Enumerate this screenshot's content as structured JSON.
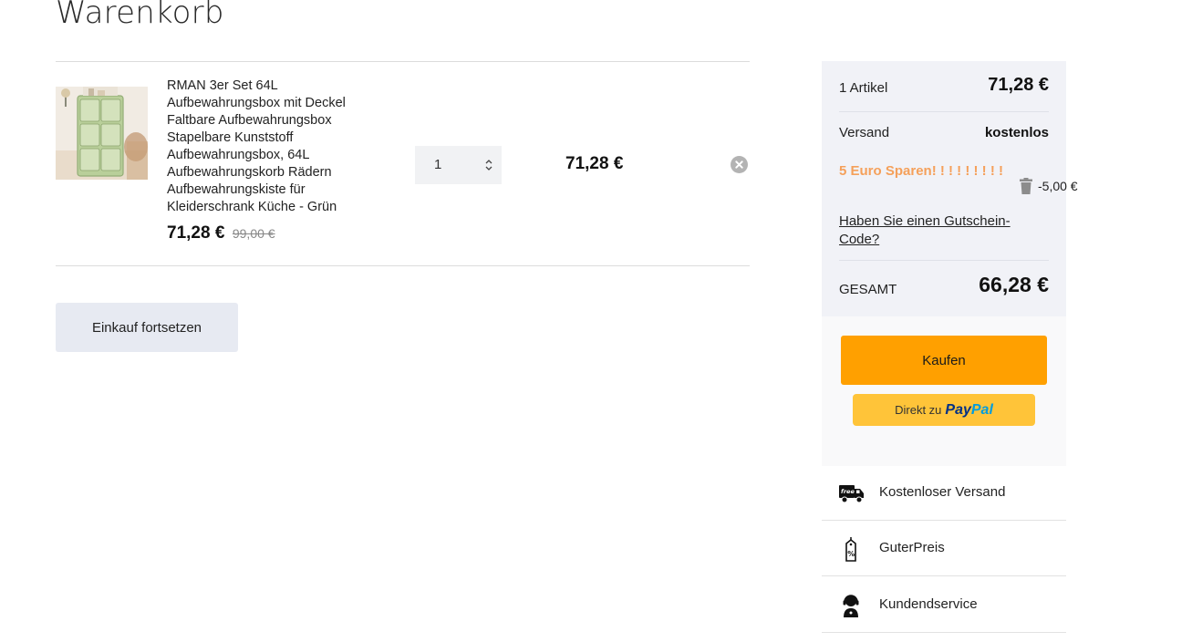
{
  "page": {
    "title": "Warenkorb"
  },
  "cart": {
    "items": [
      {
        "name": "RMAN 3er Set 64L Aufbewahrungsbox mit Deckel Faltbare Aufbewahrungsbox Stapelbare Kunststoff Aufbewahrungsbox, 64L Aufbewahrungskorb Rädern Aufbewahrungskiste für Kleiderschrank Küche - Grün",
        "price": "71,28 €",
        "old_price": "99,00 €",
        "quantity": "1",
        "line_total": "71,28 €"
      }
    ],
    "continue_label": "Einkauf fortsetzen"
  },
  "summary": {
    "items_label": "1 Artikel",
    "items_value": "71,28 €",
    "shipping_label": "Versand",
    "shipping_value": "kostenlos",
    "promo_name": "5 Euro Sparen! ! ! ! ! ! ! ! !",
    "promo_amount": "-5,00 €",
    "coupon_link": "Haben Sie einen Gutschein-Code?",
    "total_label": "GESAMT",
    "total_value": "66,28 €"
  },
  "checkout": {
    "buy_label": "Kaufen",
    "paypal_prefix": "Direkt zu",
    "paypal_pay": "Pay",
    "paypal_pal": "Pal"
  },
  "features": [
    {
      "label": "Kostenloser Versand",
      "icon": "free-shipping-truck-icon"
    },
    {
      "label": "GuterPreis",
      "icon": "price-tag-percent-icon"
    },
    {
      "label": "Kundendservice",
      "icon": "customer-service-headset-icon"
    }
  ],
  "colors": {
    "accent_orange": "#ffa000",
    "paypal_yellow": "#ffc439",
    "promo_text": "#f5a05a",
    "summary_bg": "#f1f2f7",
    "continue_bg": "#e7eaf2"
  }
}
